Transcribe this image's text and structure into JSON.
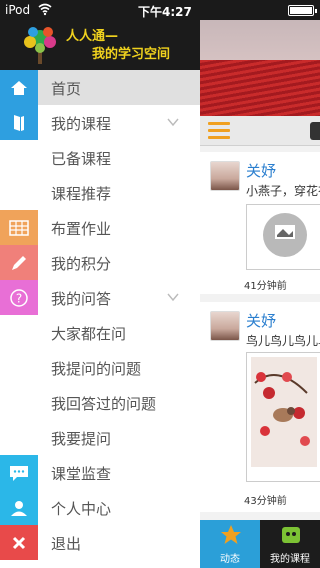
{
  "status_bar": {
    "carrier": "iPod",
    "time": "下午4:27"
  },
  "drawer": {
    "title_line1": "人人通—",
    "title_line2": "我的学习空间",
    "items": [
      {
        "label": "首页",
        "icon": "home-icon",
        "icon_bg": "#2e9fe0",
        "active": true
      },
      {
        "label": "我的课程",
        "icon": "book-icon",
        "icon_bg": "#2e9fe0",
        "expandable": true
      },
      {
        "label": "已备课程"
      },
      {
        "label": "课程推荐"
      },
      {
        "label": "布置作业",
        "icon": "grid-icon",
        "icon_bg": "#f0a35a"
      },
      {
        "label": "我的积分",
        "icon": "pencil-icon",
        "icon_bg": "#f0807a"
      },
      {
        "label": "我的问答",
        "icon": "question-icon",
        "icon_bg": "#e86fd6",
        "expandable": true
      },
      {
        "label": "大家都在问"
      },
      {
        "label": "我提问的问题"
      },
      {
        "label": "我回答过的问题"
      },
      {
        "label": "我要提问"
      },
      {
        "label": "课堂监查",
        "icon": "chat-icon",
        "icon_bg": "#2bb7e8"
      },
      {
        "label": "个人中心",
        "icon": "person-icon",
        "icon_bg": "#2bb7e8"
      },
      {
        "label": "退出",
        "icon": "close-icon",
        "icon_bg": "#e84a4a"
      }
    ]
  },
  "feed": {
    "posts": [
      {
        "name": "关妤",
        "text": "小燕子，穿花衣",
        "time": "41分钟前"
      },
      {
        "name": "关妤",
        "text": "鸟儿鸟儿鸟儿鸟",
        "time": "43分钟前"
      }
    ]
  },
  "tabbar": {
    "tabs": [
      {
        "label": "动态",
        "active": true
      },
      {
        "label": "我的课程"
      }
    ]
  },
  "colors": {
    "accent_blue": "#2e9fe0",
    "title_yellow": "#f0d21e",
    "name_blue": "#2b7fcf",
    "orange": "#f0a020"
  }
}
